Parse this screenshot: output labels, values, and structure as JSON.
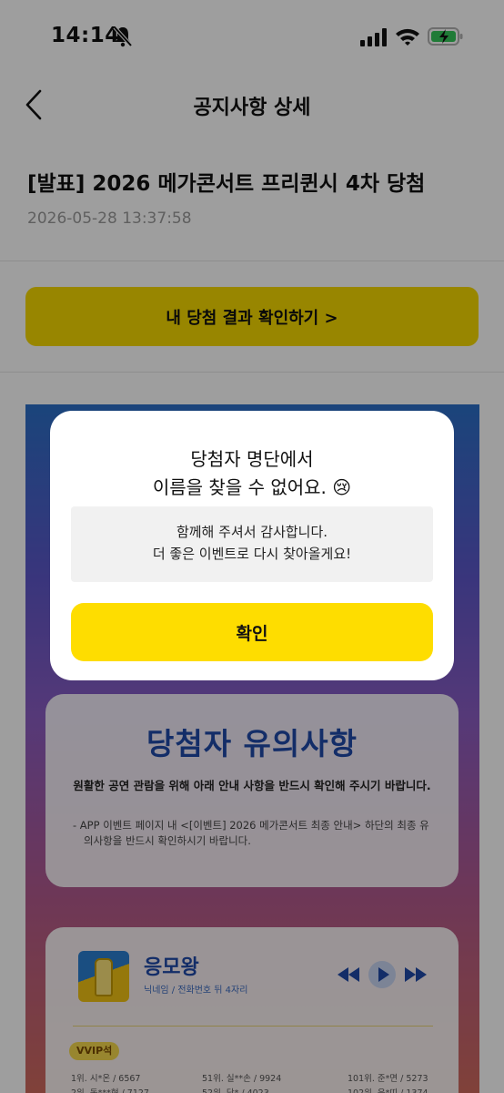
{
  "status_bar": {
    "time": "14:14"
  },
  "header": {
    "title": "공지사항 상세"
  },
  "notice": {
    "title": "[발표] 2026 메가콘서트 프리퀸시 4차 당첨",
    "date": "2026-05-28 13:37:58",
    "result_button_label": "내 당첨 결과 확인하기 >"
  },
  "poster": {
    "notes": {
      "title": "당첨자 유의사항",
      "subtitle": "원활한 공연 관람을 위해 아래 안내 사항을 반드시 확인해 주시기 바랍니다.",
      "bullet": "- APP 이벤트 페이지 내 <[이벤트] 2026 메가콘서트 최종 안내> 하단의 최종 유의사항을 반드시 확인하시기 바랍니다."
    },
    "card": {
      "song_title": "응모왕",
      "song_sub": "닉네임 / 전화번호 뒤 4자리",
      "tier": "VVIP석",
      "winners": [
        "1위. 시*온 / 6567",
        "51위. 실**손 / 9924",
        "101위. 준*면 / 5273",
        "2위. 동***현 / 7127",
        "52위. 당* / 4023",
        "102위. 윤*띠 / 1374"
      ]
    }
  },
  "dialog": {
    "message_line1": "당첨자 명단에서",
    "message_line2": "이름을 찾을 수 없어요. 😢",
    "info_line1": "함께해 주셔서 감사합니다.",
    "info_line2": "더 좋은 이벤트로 다시 찾아올게요!",
    "confirm_label": "확인"
  },
  "colors": {
    "accent_yellow": "#fedd00",
    "result_button_dimmed": "#a38b00",
    "poster_blue": "#1f4aa8"
  },
  "icons": [
    "bell-muted-icon",
    "signal-icon",
    "wifi-icon",
    "battery-charging-icon",
    "back-icon",
    "rewind-icon",
    "play-icon",
    "fast-forward-icon",
    "crying-face-emoji"
  ]
}
